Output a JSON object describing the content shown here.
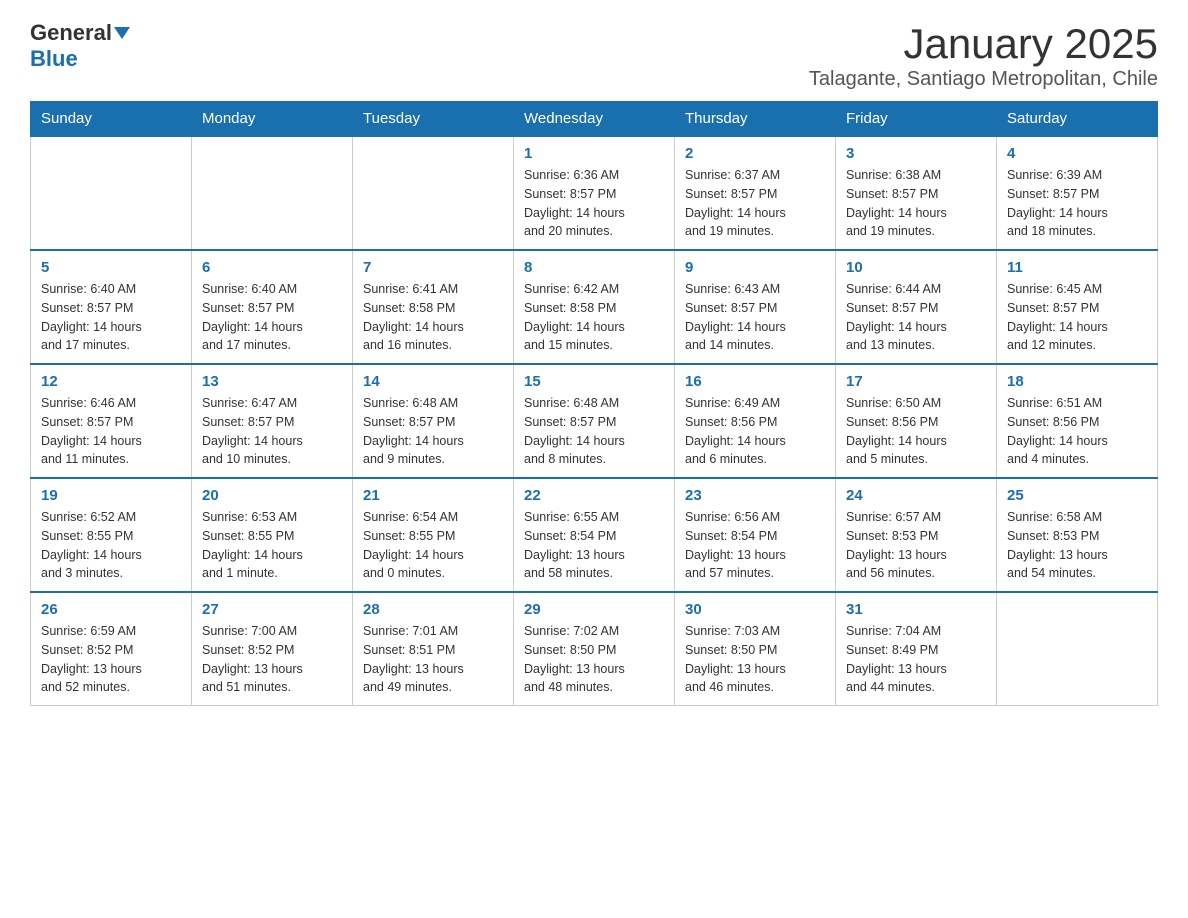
{
  "logo": {
    "text_general": "General",
    "text_blue": "Blue"
  },
  "title": "January 2025",
  "location": "Talagante, Santiago Metropolitan, Chile",
  "days_of_week": [
    "Sunday",
    "Monday",
    "Tuesday",
    "Wednesday",
    "Thursday",
    "Friday",
    "Saturday"
  ],
  "weeks": [
    [
      {
        "day": "",
        "info": ""
      },
      {
        "day": "",
        "info": ""
      },
      {
        "day": "",
        "info": ""
      },
      {
        "day": "1",
        "info": "Sunrise: 6:36 AM\nSunset: 8:57 PM\nDaylight: 14 hours\nand 20 minutes."
      },
      {
        "day": "2",
        "info": "Sunrise: 6:37 AM\nSunset: 8:57 PM\nDaylight: 14 hours\nand 19 minutes."
      },
      {
        "day": "3",
        "info": "Sunrise: 6:38 AM\nSunset: 8:57 PM\nDaylight: 14 hours\nand 19 minutes."
      },
      {
        "day": "4",
        "info": "Sunrise: 6:39 AM\nSunset: 8:57 PM\nDaylight: 14 hours\nand 18 minutes."
      }
    ],
    [
      {
        "day": "5",
        "info": "Sunrise: 6:40 AM\nSunset: 8:57 PM\nDaylight: 14 hours\nand 17 minutes."
      },
      {
        "day": "6",
        "info": "Sunrise: 6:40 AM\nSunset: 8:57 PM\nDaylight: 14 hours\nand 17 minutes."
      },
      {
        "day": "7",
        "info": "Sunrise: 6:41 AM\nSunset: 8:58 PM\nDaylight: 14 hours\nand 16 minutes."
      },
      {
        "day": "8",
        "info": "Sunrise: 6:42 AM\nSunset: 8:58 PM\nDaylight: 14 hours\nand 15 minutes."
      },
      {
        "day": "9",
        "info": "Sunrise: 6:43 AM\nSunset: 8:57 PM\nDaylight: 14 hours\nand 14 minutes."
      },
      {
        "day": "10",
        "info": "Sunrise: 6:44 AM\nSunset: 8:57 PM\nDaylight: 14 hours\nand 13 minutes."
      },
      {
        "day": "11",
        "info": "Sunrise: 6:45 AM\nSunset: 8:57 PM\nDaylight: 14 hours\nand 12 minutes."
      }
    ],
    [
      {
        "day": "12",
        "info": "Sunrise: 6:46 AM\nSunset: 8:57 PM\nDaylight: 14 hours\nand 11 minutes."
      },
      {
        "day": "13",
        "info": "Sunrise: 6:47 AM\nSunset: 8:57 PM\nDaylight: 14 hours\nand 10 minutes."
      },
      {
        "day": "14",
        "info": "Sunrise: 6:48 AM\nSunset: 8:57 PM\nDaylight: 14 hours\nand 9 minutes."
      },
      {
        "day": "15",
        "info": "Sunrise: 6:48 AM\nSunset: 8:57 PM\nDaylight: 14 hours\nand 8 minutes."
      },
      {
        "day": "16",
        "info": "Sunrise: 6:49 AM\nSunset: 8:56 PM\nDaylight: 14 hours\nand 6 minutes."
      },
      {
        "day": "17",
        "info": "Sunrise: 6:50 AM\nSunset: 8:56 PM\nDaylight: 14 hours\nand 5 minutes."
      },
      {
        "day": "18",
        "info": "Sunrise: 6:51 AM\nSunset: 8:56 PM\nDaylight: 14 hours\nand 4 minutes."
      }
    ],
    [
      {
        "day": "19",
        "info": "Sunrise: 6:52 AM\nSunset: 8:55 PM\nDaylight: 14 hours\nand 3 minutes."
      },
      {
        "day": "20",
        "info": "Sunrise: 6:53 AM\nSunset: 8:55 PM\nDaylight: 14 hours\nand 1 minute."
      },
      {
        "day": "21",
        "info": "Sunrise: 6:54 AM\nSunset: 8:55 PM\nDaylight: 14 hours\nand 0 minutes."
      },
      {
        "day": "22",
        "info": "Sunrise: 6:55 AM\nSunset: 8:54 PM\nDaylight: 13 hours\nand 58 minutes."
      },
      {
        "day": "23",
        "info": "Sunrise: 6:56 AM\nSunset: 8:54 PM\nDaylight: 13 hours\nand 57 minutes."
      },
      {
        "day": "24",
        "info": "Sunrise: 6:57 AM\nSunset: 8:53 PM\nDaylight: 13 hours\nand 56 minutes."
      },
      {
        "day": "25",
        "info": "Sunrise: 6:58 AM\nSunset: 8:53 PM\nDaylight: 13 hours\nand 54 minutes."
      }
    ],
    [
      {
        "day": "26",
        "info": "Sunrise: 6:59 AM\nSunset: 8:52 PM\nDaylight: 13 hours\nand 52 minutes."
      },
      {
        "day": "27",
        "info": "Sunrise: 7:00 AM\nSunset: 8:52 PM\nDaylight: 13 hours\nand 51 minutes."
      },
      {
        "day": "28",
        "info": "Sunrise: 7:01 AM\nSunset: 8:51 PM\nDaylight: 13 hours\nand 49 minutes."
      },
      {
        "day": "29",
        "info": "Sunrise: 7:02 AM\nSunset: 8:50 PM\nDaylight: 13 hours\nand 48 minutes."
      },
      {
        "day": "30",
        "info": "Sunrise: 7:03 AM\nSunset: 8:50 PM\nDaylight: 13 hours\nand 46 minutes."
      },
      {
        "day": "31",
        "info": "Sunrise: 7:04 AM\nSunset: 8:49 PM\nDaylight: 13 hours\nand 44 minutes."
      },
      {
        "day": "",
        "info": ""
      }
    ]
  ]
}
